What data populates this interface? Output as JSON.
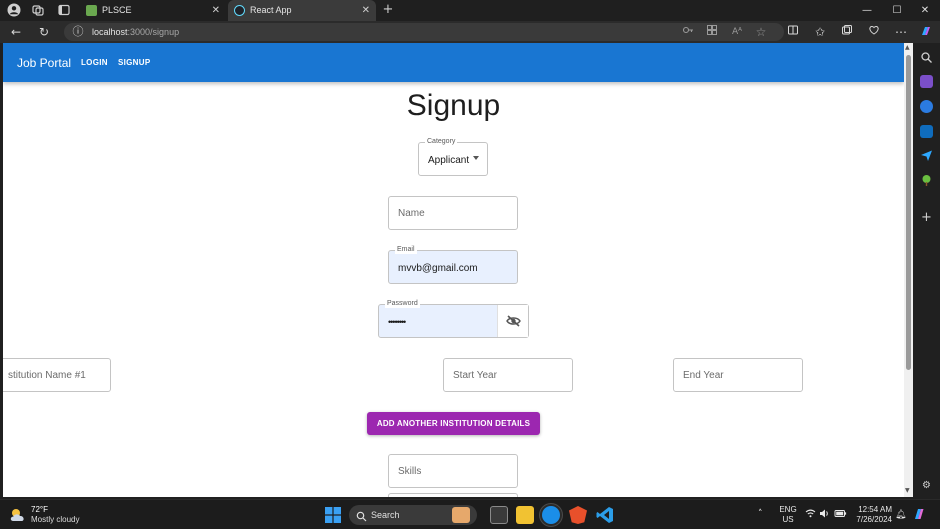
{
  "browser": {
    "tabs": [
      {
        "label": "PLSCE",
        "active": false
      },
      {
        "label": "React App",
        "active": true
      }
    ],
    "url": {
      "host": "localhost",
      "rest": ":3000/signup"
    },
    "icons": {
      "profile": "profile-icon",
      "workspaces": "workspaces-icon",
      "tab_actions": "tab-actions-icon",
      "close_tab": "✕",
      "new_tab": "+",
      "back": "←",
      "refresh": "↻",
      "info": "ⓘ",
      "minimize": "—",
      "maximize": "☐",
      "close": "✕",
      "more": "⋯"
    }
  },
  "app": {
    "brand": "Job Portal",
    "nav": [
      "LOGIN",
      "SIGNUP"
    ],
    "primary_color": "#1976d2",
    "accent_color": "#9c27b0"
  },
  "form": {
    "title": "Signup",
    "category": {
      "label": "Category",
      "value": "Applicant"
    },
    "name": {
      "placeholder": "Name"
    },
    "email": {
      "label": "Email",
      "value": "mvvb@gmail.com"
    },
    "password": {
      "label": "Password",
      "value": "••••••••"
    },
    "institution": {
      "placeholder": "stitution Name #1"
    },
    "start_year": {
      "placeholder": "Start Year"
    },
    "end_year": {
      "placeholder": "End Year"
    },
    "add_institution_button": "ADD ANOTHER INSTITUTION DETAILS",
    "skills": {
      "placeholder": "Skills"
    }
  },
  "taskbar": {
    "weather": {
      "temp": "72°F",
      "desc": "Mostly cloudy"
    },
    "search": "Search",
    "lang": [
      "ENG",
      "US"
    ],
    "time": "12:54 AM",
    "date": "7/26/2024"
  }
}
